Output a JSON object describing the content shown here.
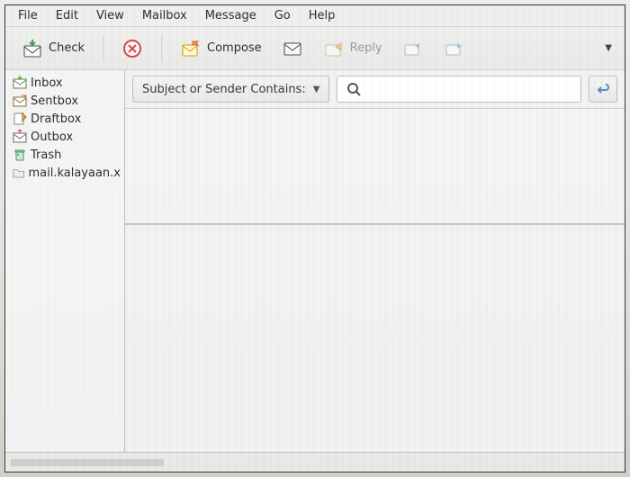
{
  "menu": {
    "file": "File",
    "edit": "Edit",
    "view": "View",
    "mailbox": "Mailbox",
    "message": "Message",
    "go": "Go",
    "help": "Help"
  },
  "toolbar": {
    "check": "Check",
    "compose": "Compose",
    "reply": "Reply"
  },
  "folders": {
    "inbox": "Inbox",
    "sentbox": "Sentbox",
    "draftbox": "Draftbox",
    "outbox": "Outbox",
    "trash": "Trash",
    "account": "mail.kalayaan.x"
  },
  "filter": {
    "label": "Subject or Sender Contains:",
    "search_placeholder": ""
  }
}
